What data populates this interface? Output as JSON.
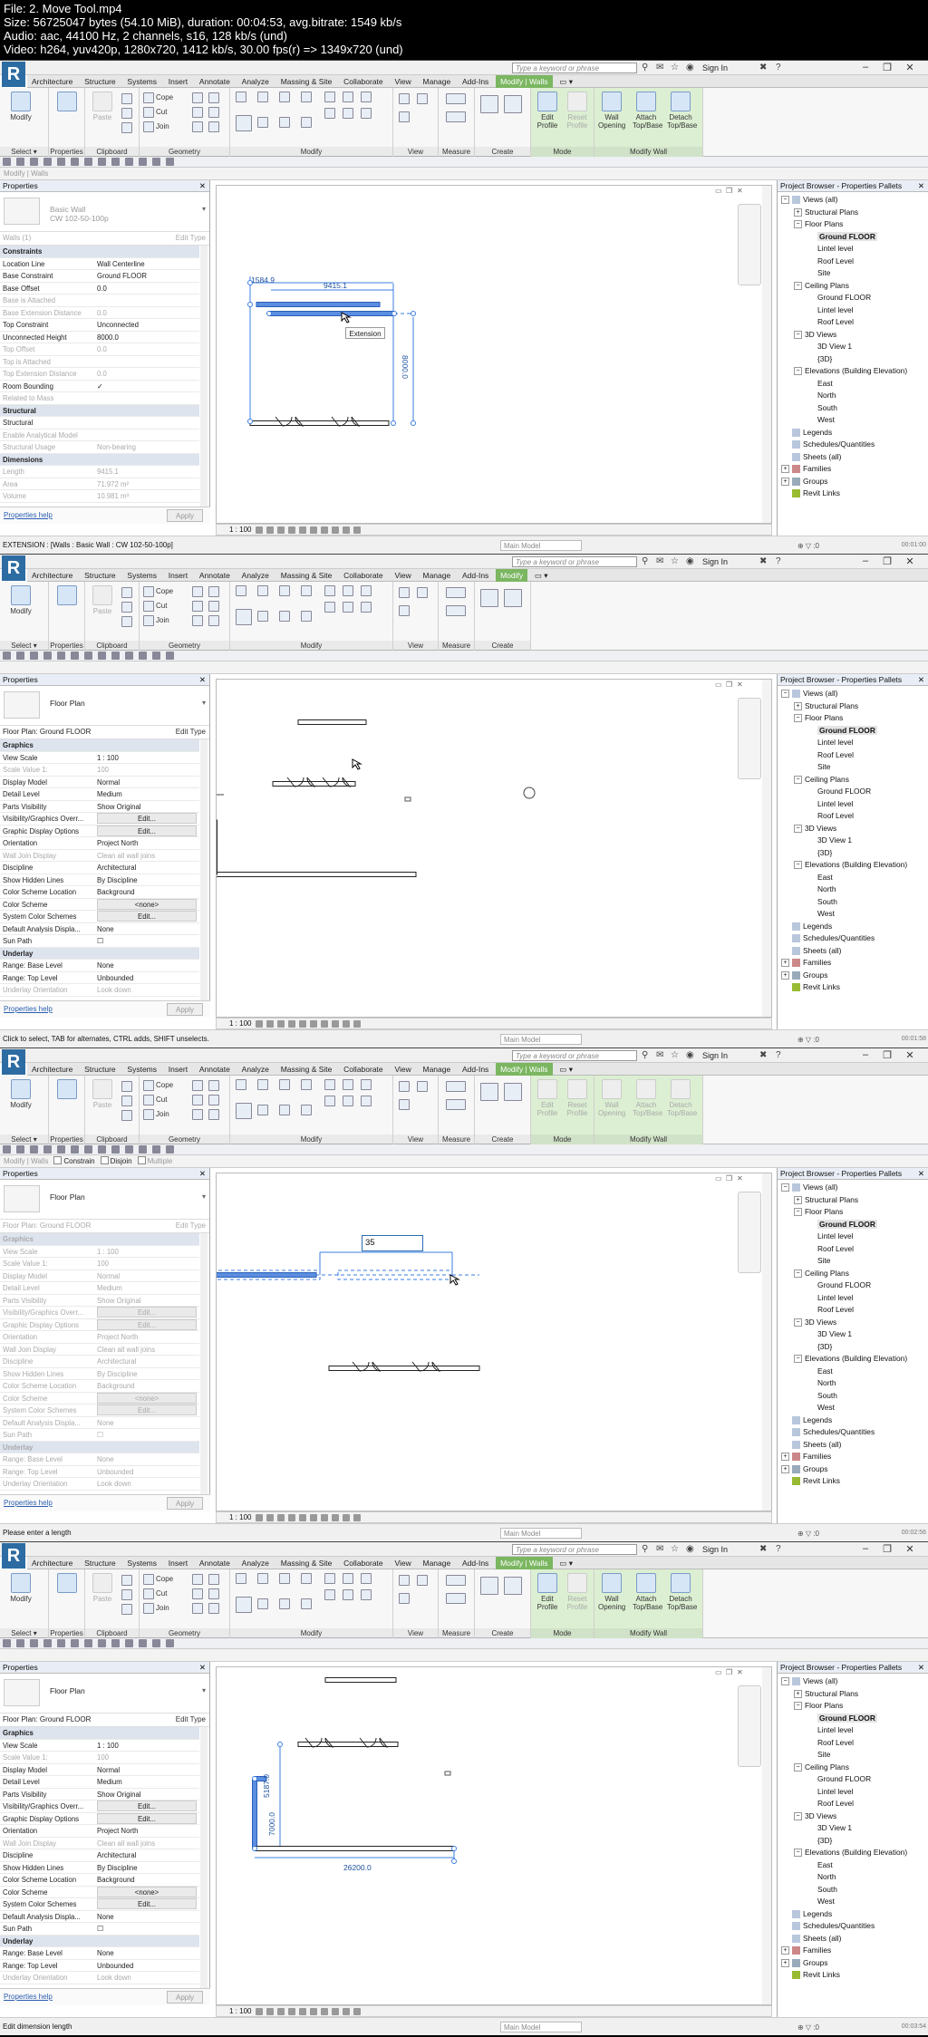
{
  "header": {
    "line1": "File: 2. Move Tool.mp4",
    "line2": "Size: 56725047 bytes (54.10 MiB), duration: 00:04:53, avg.bitrate: 1549 kb/s",
    "line3": "Audio: aac, 44100 Hz, 2 channels, s16, 128 kb/s (und)",
    "line4": "Video: h264, yuv420p, 1280x720, 1412 kb/s, 30.00 fps(r) => 1349x720 (und)"
  },
  "titlebar": {
    "search_placeholder": "Type a keyword or phrase",
    "signin": "Sign In",
    "minimize": "–",
    "restore": "❐",
    "close": "✕"
  },
  "tabs": {
    "architecture": "Architecture",
    "structure": "Structure",
    "systems": "Systems",
    "insert": "Insert",
    "annotate": "Annotate",
    "analyze": "Analyze",
    "massing": "Massing & Site",
    "collaborate": "Collaborate",
    "view": "View",
    "manage": "Manage",
    "addins": "Add-Ins",
    "modify": "Modify",
    "modify_walls": "Modify | Walls"
  },
  "ribbon": {
    "modify": "Modify",
    "select": "Select ▾",
    "properties": "Properties",
    "clipboard": "Clipboard",
    "paste": "Paste",
    "cope": "Cope",
    "cut": "Cut",
    "join": "Join",
    "geometry": "Geometry",
    "modify_panel": "Modify",
    "view_panel": "View",
    "measure": "Measure",
    "create": "Create",
    "mode": "Mode",
    "edit_profile": "Edit Profile",
    "reset_profile": "Reset Profile",
    "modify_wall": "Modify Wall",
    "wall_opening": "Wall Opening",
    "attach": "Attach Top/Base",
    "detach": "Detach Top/Base"
  },
  "options": {
    "modify_walls_label": "Modify | Walls",
    "constrain": "Constrain",
    "disjoin": "Disjoin",
    "multiple": "Multiple"
  },
  "properties_common": {
    "title": "Properties",
    "close": "✕",
    "help": "Properties help",
    "apply": "Apply",
    "edit_type": "Edit Type"
  },
  "frame1": {
    "type_name": "Basic Wall",
    "type_sub": "CW 102-50-100p",
    "instance": "Walls (1)",
    "rows": [
      {
        "k": "Constraints",
        "v": "",
        "g": true
      },
      {
        "k": "Location Line",
        "v": "Wall Centerline"
      },
      {
        "k": "Base Constraint",
        "v": "Ground FLOOR"
      },
      {
        "k": "Base Offset",
        "v": "0.0"
      },
      {
        "k": "Base is Attached",
        "v": "",
        "d": true
      },
      {
        "k": "Base Extension Distance",
        "v": "0.0",
        "d": true
      },
      {
        "k": "Top Constraint",
        "v": "Unconnected"
      },
      {
        "k": "Unconnected Height",
        "v": "8000.0"
      },
      {
        "k": "Top Offset",
        "v": "0.0",
        "d": true
      },
      {
        "k": "Top is Attached",
        "v": "",
        "d": true
      },
      {
        "k": "Top Extension Distance",
        "v": "0.0",
        "d": true
      },
      {
        "k": "Room Bounding",
        "v": "✓"
      },
      {
        "k": "Related to Mass",
        "v": "",
        "d": true
      },
      {
        "k": "Structural",
        "v": "",
        "g": true
      },
      {
        "k": "Structural",
        "v": ""
      },
      {
        "k": "Enable Analytical Model",
        "v": "",
        "d": true
      },
      {
        "k": "Structural Usage",
        "v": "Non-bearing",
        "d": true
      },
      {
        "k": "Dimensions",
        "v": "",
        "g": true
      },
      {
        "k": "Length",
        "v": "9415.1",
        "d": true
      },
      {
        "k": "Area",
        "v": "71.972 m²",
        "d": true
      },
      {
        "k": "Volume",
        "v": "10.981 m³",
        "d": true
      }
    ],
    "status": "EXTENSION : [Walls : Basic Wall : CW 102-50-100p]",
    "dim_top": "9415.1",
    "dim_left": "1584.9",
    "dim_right": "8000.0",
    "tooltip": "Extension",
    "scale": "1 : 100",
    "ts": "00:01:00"
  },
  "fp": {
    "type_name": "Floor Plan",
    "instance": "Floor Plan: Ground FLOOR",
    "rows": [
      {
        "k": "Graphics",
        "v": "",
        "g": true
      },
      {
        "k": "View Scale",
        "v": "1 : 100"
      },
      {
        "k": "Scale Value 1:",
        "v": "100",
        "d": true
      },
      {
        "k": "Display Model",
        "v": "Normal"
      },
      {
        "k": "Detail Level",
        "v": "Medium"
      },
      {
        "k": "Parts Visibility",
        "v": "Show Original"
      },
      {
        "k": "Visibility/Graphics Overr...",
        "v": "Edit...",
        "b": true
      },
      {
        "k": "Graphic Display Options",
        "v": "Edit...",
        "b": true
      },
      {
        "k": "Orientation",
        "v": "Project North"
      },
      {
        "k": "Wall Join Display",
        "v": "Clean all wall joins",
        "d": true
      },
      {
        "k": "Discipline",
        "v": "Architectural"
      },
      {
        "k": "Show Hidden Lines",
        "v": "By Discipline"
      },
      {
        "k": "Color Scheme Location",
        "v": "Background"
      },
      {
        "k": "Color Scheme",
        "v": "<none>",
        "b": true
      },
      {
        "k": "System Color Schemes",
        "v": "Edit...",
        "b": true
      },
      {
        "k": "Default Analysis Displa...",
        "v": "None"
      },
      {
        "k": "Sun Path",
        "v": "☐"
      },
      {
        "k": "Underlay",
        "v": "",
        "g": true
      },
      {
        "k": "Range: Base Level",
        "v": "None"
      },
      {
        "k": "Range: Top Level",
        "v": "Unbounded"
      },
      {
        "k": "Underlay Orientation",
        "v": "Look down",
        "d": true
      }
    ]
  },
  "frame2": {
    "status": "Click to select, TAB for alternates, CTRL adds, SHIFT unselects.",
    "scale": "1 : 100",
    "ts": "00:01:58"
  },
  "frame3": {
    "status": "Please enter a length",
    "dim_input": "35",
    "scale": "1 : 100",
    "ts": "00:02:56"
  },
  "frame4": {
    "status": "Edit dimension length",
    "dim_bottom": "26200.0",
    "dim_v1": "5187.0",
    "dim_v2": "7000.0",
    "scale": "1 : 100",
    "ts": "00:03:54"
  },
  "browser": {
    "title": "Project Browser - Properties Pallets",
    "nodes": [
      {
        "t": "Views (all)",
        "l": 0,
        "tg": "−",
        "ic": "v"
      },
      {
        "t": "Structural Plans",
        "l": 1,
        "tg": "+"
      },
      {
        "t": "Floor Plans",
        "l": 1,
        "tg": "−"
      },
      {
        "t": "Ground FLOOR",
        "l": 2,
        "b": true
      },
      {
        "t": "Lintel level",
        "l": 2
      },
      {
        "t": "Roof Level",
        "l": 2
      },
      {
        "t": "Site",
        "l": 2
      },
      {
        "t": "Ceiling Plans",
        "l": 1,
        "tg": "−"
      },
      {
        "t": "Ground FLOOR",
        "l": 2
      },
      {
        "t": "Lintel level",
        "l": 2
      },
      {
        "t": "Roof Level",
        "l": 2
      },
      {
        "t": "3D Views",
        "l": 1,
        "tg": "−"
      },
      {
        "t": "3D View 1",
        "l": 2
      },
      {
        "t": "{3D}",
        "l": 2
      },
      {
        "t": "Elevations (Building Elevation)",
        "l": 1,
        "tg": "−"
      },
      {
        "t": "East",
        "l": 2
      },
      {
        "t": "North",
        "l": 2
      },
      {
        "t": "South",
        "l": 2
      },
      {
        "t": "West",
        "l": 2
      },
      {
        "t": "Legends",
        "l": 0,
        "ic": "v"
      },
      {
        "t": "Schedules/Quantities",
        "l": 0,
        "ic": "v"
      },
      {
        "t": "Sheets (all)",
        "l": 0,
        "ic": "v"
      },
      {
        "t": "Families",
        "l": 0,
        "tg": "+",
        "ic": "fam"
      },
      {
        "t": "Groups",
        "l": 0,
        "tg": "+",
        "ic": "grp"
      },
      {
        "t": "Revit Links",
        "l": 0,
        "ic": "rl"
      }
    ]
  },
  "statusbar": {
    "model": "Main Model",
    "tail": "⊕ ▽ :0"
  },
  "colors": {
    "accent": "#2d6ca2",
    "context_tab": "#7bb661",
    "select_blue": "#1a4f9c"
  }
}
